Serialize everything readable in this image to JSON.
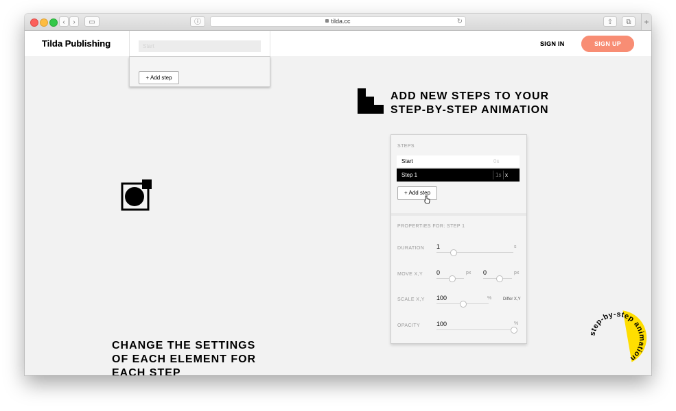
{
  "browser": {
    "url": "tilda.cc",
    "info_icon": "info-icon",
    "reload_icon": "reload-icon"
  },
  "site": {
    "brand": "Tilda Publishing",
    "sign_in": "SIGN IN",
    "sign_up": "SIGN UP",
    "accent": "#f88d74"
  },
  "top_panel": {
    "start_label": "Start",
    "add_step": "+ Add step"
  },
  "heading1": {
    "line1": "ADD NEW STEPS TO YOUR",
    "line2": "STEP-BY-STEP ANIMATION"
  },
  "heading2": {
    "line1": "CHANGE THE SETTINGS",
    "line2": "OF EACH ELEMENT FOR",
    "line3": "EACH STEP"
  },
  "steps_panel": {
    "title": "STEPS",
    "rows": [
      {
        "name": "Start",
        "time": "0s"
      },
      {
        "name": "Step 1",
        "time": "1s",
        "close": "x"
      }
    ],
    "add_step": "+ Add step",
    "properties_title": "PROPERTIES FOR: STEP 1",
    "duration": {
      "label": "DURATION",
      "value": "1",
      "unit": "s"
    },
    "move": {
      "label": "MOVE X,Y",
      "x": "0",
      "y": "0",
      "unit": "px"
    },
    "scale": {
      "label": "SCALE X,Y",
      "value": "100",
      "unit": "%",
      "differ": "Differ X,Y"
    },
    "opacity": {
      "label": "OPACITY",
      "value": "100",
      "unit": "%"
    }
  },
  "badge": {
    "text": "step-by-step animation",
    "color": "#ffde00"
  }
}
